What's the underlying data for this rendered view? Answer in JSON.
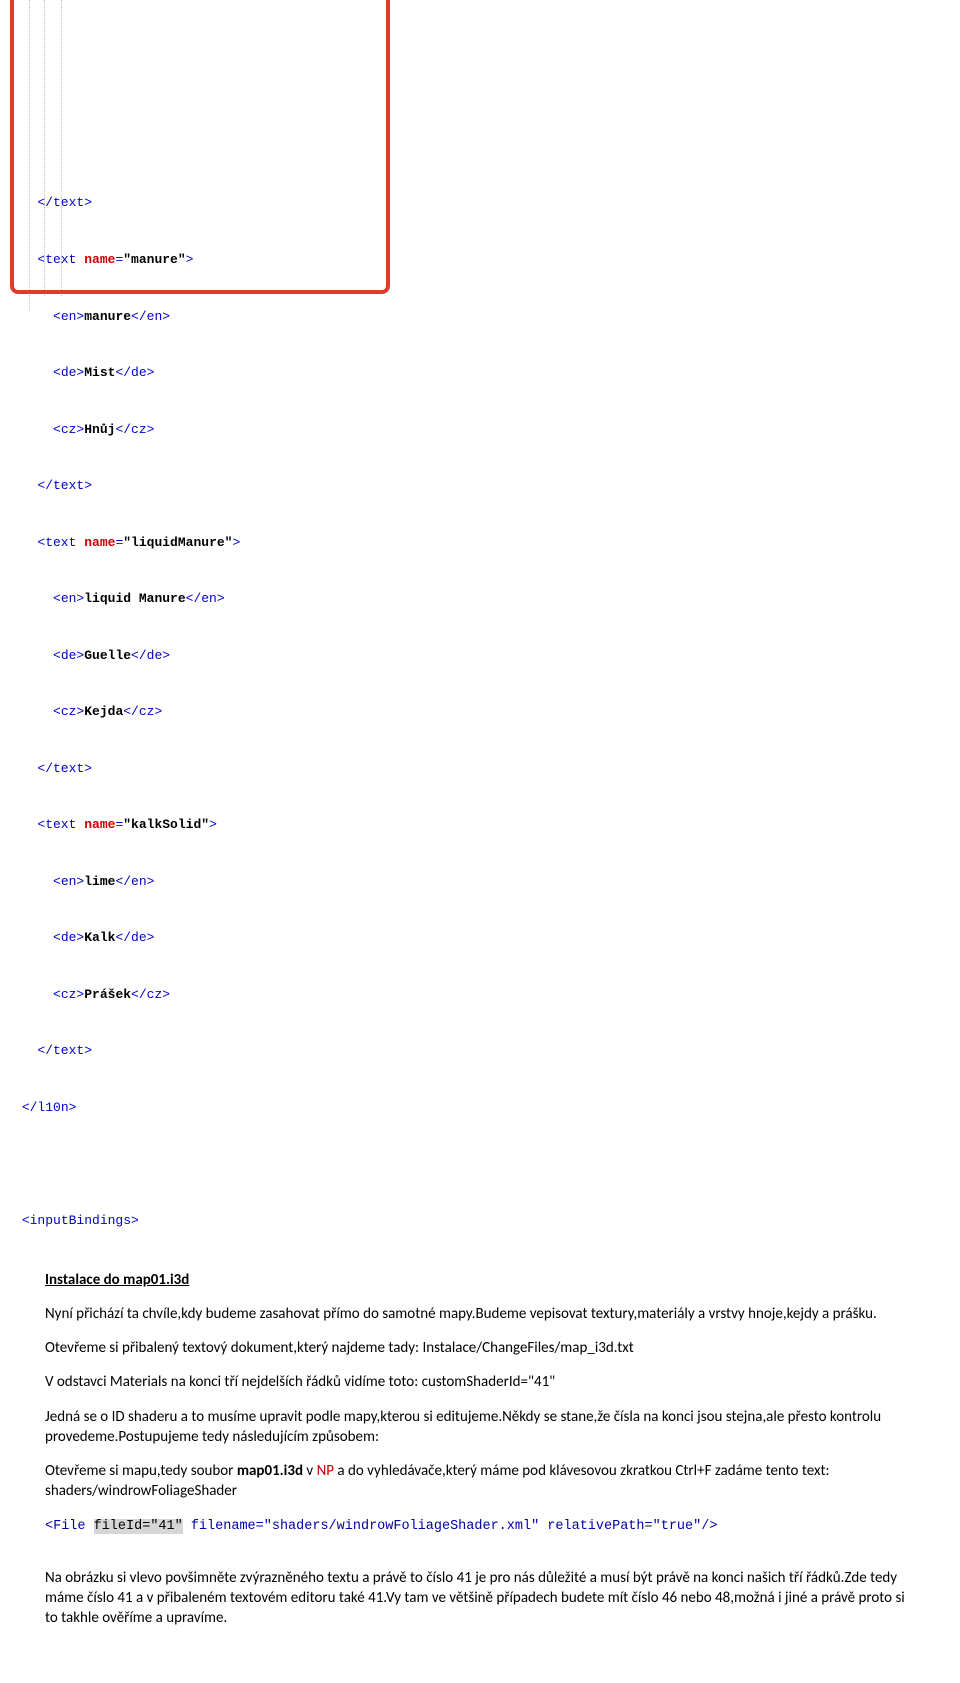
{
  "code": {
    "line1": "</text>",
    "line2a": "<text ",
    "line2b": "name",
    "line2c": "=",
    "line2d": "\"manure\"",
    "line2e": ">",
    "line3a": "<en>",
    "line3b": "manure",
    "line3c": "</en>",
    "line4a": "<de>",
    "line4b": "Mist",
    "line4c": "</de>",
    "line5a": "<cz>",
    "line5b": "Hnůj",
    "line5c": "</cz>",
    "line6": "</text>",
    "line7a": "<text ",
    "line7b": "name",
    "line7c": "=",
    "line7d": "\"liquidManure\"",
    "line7e": ">",
    "line8a": "<en>",
    "line8b": "liquid Manure",
    "line8c": "</en>",
    "line9a": "<de>",
    "line9b": "Guelle",
    "line9c": "</de>",
    "line10a": "<cz>",
    "line10b": "Kejda",
    "line10c": "</cz>",
    "line11": "</text>",
    "line12a": "<text ",
    "line12b": "name",
    "line12c": "=",
    "line12d": "\"kalkSolid\"",
    "line12e": ">",
    "line13a": "<en>",
    "line13b": "lime",
    "line13c": "</en>",
    "line14a": "<de>",
    "line14b": "Kalk",
    "line14c": "</de>",
    "line15a": "<cz>",
    "line15b": "Prášek",
    "line15c": "</cz>",
    "line16": "</text>",
    "line17": "</l10n>",
    "line18": "",
    "line19": "<inputBindings>"
  },
  "article": {
    "heading": "Instalace do map01.i3d",
    "p1": "Nyní přichází ta chvíle,kdy budeme zasahovat přímo do samotné mapy.Budeme vepisovat textury,materiály a vrstvy hnoje,kejdy a prášku.",
    "p2": "Otevřeme si přibalený textový dokument,který najdeme tady: Instalace/ChangeFiles/map_i3d.txt",
    "p3": "V odstavci Materials na konci tří nejdelších řádků vidíme toto: customShaderId=\"41\"",
    "p4": "Jedná se o ID shaderu a to musíme upravit podle mapy,kterou si editujeme.Někdy se stane,že čísla na konci jsou stejna,ale přesto kontrolu provedeme.Postupujeme tedy následujícím způsobem:",
    "p5_a": "Otevřeme si mapu,tedy soubor ",
    "p5_b": "map01.i3d",
    "p5_c": " v ",
    "p5_np": "NP",
    "p5_d": " a do vyhledávače,který máme pod klávesovou zkratkou Ctrl+F zadáme tento text: shaders/windrowFoliageShader",
    "file_pre": "<File ",
    "file_hl": "fileId=\"41\"",
    "file_post": " filename=\"shaders/windrowFoliageShader.xml\" relativePath=\"true\"/>",
    "p6": "Na obrázku si vlevo povšimněte zvýrazněného textu a právě to číslo 41 je pro nás důležité a musí být právě na konci našich tří řádků.Zde tedy máme číslo 41 a v přibaleném textovém editoru také 41.Vy tam ve většině případech budete mít číslo 46 nebo 48,možná i jiné a právě proto si to takhle ověříme a upravíme."
  }
}
